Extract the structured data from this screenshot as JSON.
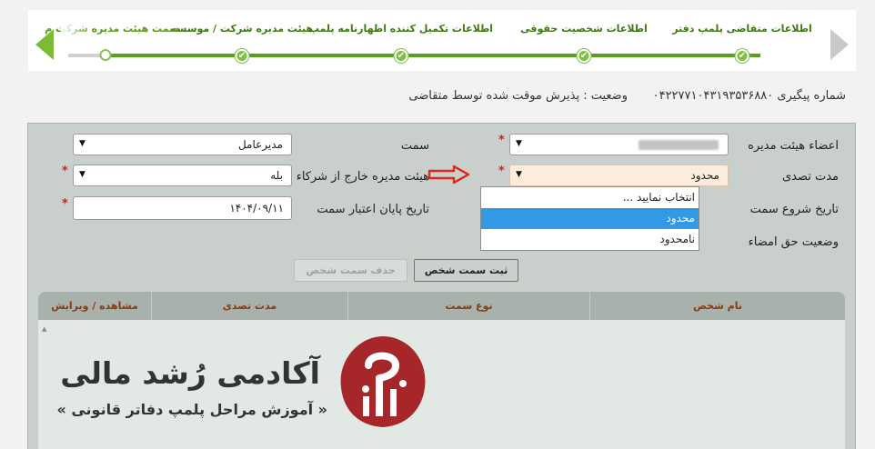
{
  "stepper": {
    "steps": [
      {
        "label": "اطلاعات متقاضی پلمپ دفتر",
        "state": "done"
      },
      {
        "label": "اطلاعات شخصیت حقوقی",
        "state": "done"
      },
      {
        "label": "اطلاعات تکمیل کننده اظهارنامه پلمپ",
        "state": "done"
      },
      {
        "label": "هیئت مدیره شرکت / موسسه",
        "state": "done"
      },
      {
        "label": "سمت هیئت مدیره شرکت م",
        "state": "current"
      }
    ],
    "check_glyph": "✔"
  },
  "tracking": {
    "number": "شماره پیگیری  ۰۴۲۲۷۷۱۰۴۳۱۹۳۵۳۶۸۸۰",
    "status": "وضعیت : پذیرش موقت شده توسط متقاضی"
  },
  "form": {
    "board_member": {
      "label": "اعضاء هیئت مدیره",
      "value": ""
    },
    "position": {
      "label": "سمت",
      "value": "مدیرعامل"
    },
    "tenure": {
      "label": "مدت تصدی",
      "value": "محدود"
    },
    "external_member": {
      "label": "هیئت مدیره خارج از شرکاء",
      "value": "بله"
    },
    "start_date": {
      "label": "تاریخ شروع سمت"
    },
    "end_date": {
      "label": "تاریخ پایان اعتبار سمت",
      "value": "۱۴۰۴/۰۹/۱۱"
    },
    "signature": {
      "label": "وضعیت حق امضاء"
    },
    "required_mark": "*",
    "caret": "▼"
  },
  "dropdown": {
    "options": [
      "انتخاب نمایید ...",
      "محدود",
      "نامحدود"
    ],
    "selected_index": 1
  },
  "buttons": {
    "register": "ثبت سمت شخص",
    "delete": "حذف سمت شخص"
  },
  "table": {
    "columns": [
      "نام شخص",
      "نوع سمت",
      "مدت تصدی",
      "مشاهده / ویرایش"
    ]
  },
  "watermark": {
    "title": "آکادمی رُشد مالی",
    "subtitle": "« آموزش مراحل پلمپ دفاتر قانونی »"
  },
  "colors": {
    "step_done": "#58a01d",
    "header_text": "#8b3a0e",
    "required": "#d2201c",
    "selection": "#3399e6",
    "logo": "#a6262a"
  }
}
